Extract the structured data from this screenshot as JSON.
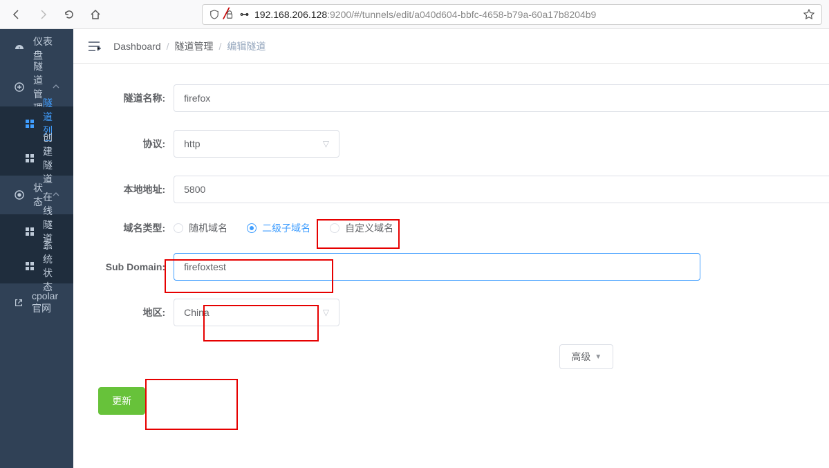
{
  "browser": {
    "url_host": "192.168.206.128",
    "url_rest": ":9200/#/tunnels/edit/a040d604-bbfc-4658-b79a-60a17b8204b9"
  },
  "sidebar": {
    "items": [
      {
        "label": "仪表盘"
      },
      {
        "label": "隧道管理"
      },
      {
        "label": "隧道列表"
      },
      {
        "label": "创建隧道"
      },
      {
        "label": "状态"
      },
      {
        "label": "在线隧道列表"
      },
      {
        "label": "系统状态"
      },
      {
        "label": "cpolar官网"
      }
    ]
  },
  "breadcrumb": {
    "a": "Dashboard",
    "b": "隧道管理",
    "c": "编辑隧道"
  },
  "form": {
    "tunnel_name_label": "隧道名称:",
    "tunnel_name_value": "firefox",
    "protocol_label": "协议:",
    "protocol_value": "http",
    "local_addr_label": "本地地址:",
    "local_addr_value": "5800",
    "domain_type_label": "域名类型:",
    "domain_type_opts": {
      "random": "随机域名",
      "sub": "二级子域名",
      "custom": "自定义域名"
    },
    "subdomain_label": "Sub Domain:",
    "subdomain_value": "firefoxtest",
    "region_label": "地区:",
    "region_value": "China",
    "advanced_label": "高级",
    "submit_label": "更新"
  }
}
